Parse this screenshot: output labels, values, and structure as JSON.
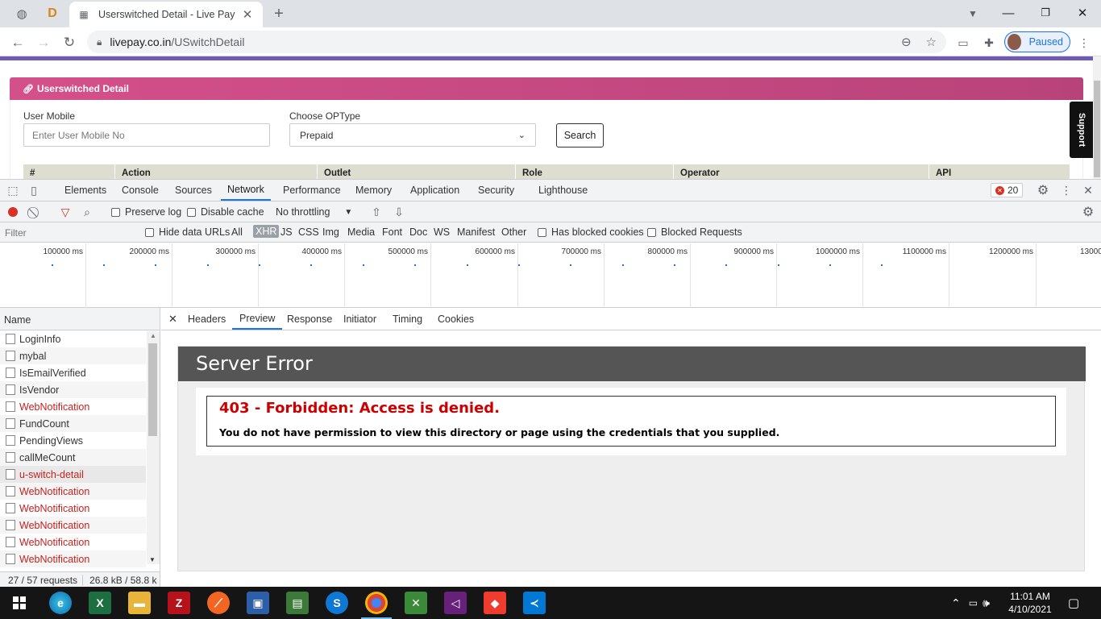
{
  "browser": {
    "tab_title": "Userswitched Detail - Live Pay",
    "url_host": "livepay.co.in",
    "url_path": "/USwitchDetail",
    "profile_label": "Paused",
    "pinned_tab_letter": "D"
  },
  "page": {
    "card_title": "Userswitched Detail",
    "mobile_label": "User Mobile",
    "mobile_placeholder": "Enter User Mobile No",
    "optype_label": "Choose OPType",
    "optype_selected": "Prepaid",
    "search_label": "Search",
    "support_label": "Support",
    "table_headers": [
      "#",
      "Action",
      "Outlet",
      "Role",
      "Operator",
      "API"
    ]
  },
  "devtools": {
    "tabs": [
      "Elements",
      "Console",
      "Sources",
      "Network",
      "Performance",
      "Memory",
      "Application",
      "Security",
      "Lighthouse"
    ],
    "active_tab": "Network",
    "error_count": "20",
    "preserve_log": "Preserve log",
    "disable_cache": "Disable cache",
    "throttling": "No throttling",
    "filter_placeholder": "Filter",
    "hide_data_urls": "Hide data URLs",
    "filter_types": [
      "All",
      "XHR",
      "JS",
      "CSS",
      "Img",
      "Media",
      "Font",
      "Doc",
      "WS",
      "Manifest",
      "Other"
    ],
    "active_filter": "XHR",
    "has_blocked_cookies": "Has blocked cookies",
    "blocked_requests": "Blocked Requests",
    "timeline_labels": [
      "100000 ms",
      "200000 ms",
      "300000 ms",
      "400000 ms",
      "500000 ms",
      "600000 ms",
      "700000 ms",
      "800000 ms",
      "900000 ms",
      "1000000 ms",
      "1100000 ms",
      "1200000 ms",
      "13000"
    ],
    "name_header": "Name",
    "requests": [
      {
        "name": "LoginInfo",
        "error": false
      },
      {
        "name": "mybal",
        "error": false
      },
      {
        "name": "IsEmailVerified",
        "error": false
      },
      {
        "name": "IsVendor",
        "error": false
      },
      {
        "name": "WebNotification",
        "error": true
      },
      {
        "name": "FundCount",
        "error": false
      },
      {
        "name": "PendingViews",
        "error": false
      },
      {
        "name": "callMeCount",
        "error": false
      },
      {
        "name": "u-switch-detail",
        "error": true
      },
      {
        "name": "WebNotification",
        "error": true
      },
      {
        "name": "WebNotification",
        "error": true
      },
      {
        "name": "WebNotification",
        "error": true
      },
      {
        "name": "WebNotification",
        "error": true
      },
      {
        "name": "WebNotification",
        "error": true
      }
    ],
    "request_count": "27 / 57 requests",
    "transfer_size": "26.8 kB / 58.8 k",
    "detail_tabs": [
      "Headers",
      "Preview",
      "Response",
      "Initiator",
      "Timing",
      "Cookies"
    ],
    "active_detail_tab": "Preview"
  },
  "preview": {
    "header": "Server Error",
    "error_title": "403 - Forbidden: Access is denied.",
    "error_message": "You do not have permission to view this directory or page using the credentials that you supplied."
  },
  "taskbar": {
    "time": "11:01 AM",
    "date": "4/10/2021"
  },
  "colors": {
    "card_gradient_start": "#d4508a",
    "card_gradient_end": "#b8437a",
    "accent_line": "#6f5ab5",
    "error_red": "#cc0000",
    "devtools_active": "#1a73e8"
  }
}
